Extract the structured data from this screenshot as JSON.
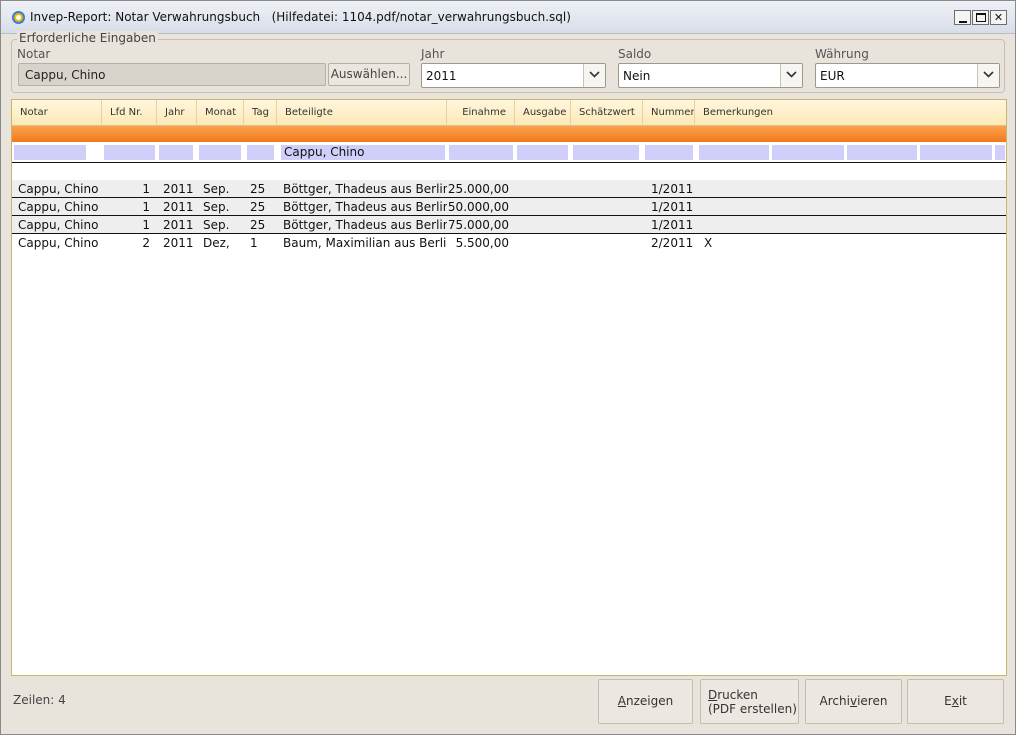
{
  "window": {
    "title": "Invep-Report: Notar Verwahrungsbuch   (Hilfedatei: 1104.pdf/notar_verwahrungsbuch.sql)",
    "controls": {
      "minimize": "_",
      "maximize": "□",
      "close": "✕"
    }
  },
  "inputs": {
    "legend": "Erforderliche Eingaben",
    "notar": {
      "label": "Notar",
      "value": "Cappu, Chino",
      "button": "Auswählen..."
    },
    "jahr": {
      "label": "Jahr",
      "value": "2011"
    },
    "saldo": {
      "label": "Saldo",
      "value": "Nein"
    },
    "waehrung": {
      "label": "Währung",
      "value": "EUR"
    }
  },
  "table": {
    "columns": [
      "Notar",
      "Lfd Nr.",
      "Jahr",
      "Monat",
      "Tag",
      "Beteiligte",
      "Einahme",
      "Ausgabe",
      "Schätzwert",
      "Nummer",
      "Bemerkungen"
    ],
    "filter": {
      "beteiligte": "Cappu, Chino"
    },
    "rows": [
      {
        "notar": "Cappu, Chino",
        "lfd": "1",
        "jahr": "2011",
        "monat": "Sep.",
        "tag": "25",
        "beteiligte": "Böttger, Thadeus aus Berlin",
        "einahme": "25.000,00",
        "ausgabe": "",
        "schaetzwert": "",
        "nummer": "1/2011",
        "bemerkungen": ""
      },
      {
        "notar": "Cappu, Chino",
        "lfd": "1",
        "jahr": "2011",
        "monat": "Sep.",
        "tag": "25",
        "beteiligte": "Böttger, Thadeus aus Berlin",
        "einahme": "50.000,00",
        "ausgabe": "",
        "schaetzwert": "",
        "nummer": "1/2011",
        "bemerkungen": ""
      },
      {
        "notar": "Cappu, Chino",
        "lfd": "1",
        "jahr": "2011",
        "monat": "Sep.",
        "tag": "25",
        "beteiligte": "Böttger, Thadeus aus Berlin",
        "einahme": "75.000,00",
        "ausgabe": "",
        "schaetzwert": "",
        "nummer": "1/2011",
        "bemerkungen": ""
      },
      {
        "notar": "Cappu, Chino",
        "lfd": "2",
        "jahr": "2011",
        "monat": "Dez,",
        "tag": "1",
        "beteiligte": "Baum, Maximilian aus Berlin",
        "einahme": "5.500,00",
        "ausgabe": "",
        "schaetzwert": "",
        "nummer": "2/2011",
        "bemerkungen": "X"
      }
    ]
  },
  "footer": {
    "status": "Zeilen: 4",
    "buttons": {
      "anzeigen_pre": "",
      "anzeigen_u": "A",
      "anzeigen_post": "nzeigen",
      "drucken_u": "D",
      "drucken_post": "rucken",
      "drucken_line2": "(PDF erstellen)",
      "archivieren_pre": "Archi",
      "archivieren_u": "v",
      "archivieren_post": "ieren",
      "exit_pre": "E",
      "exit_u": "x",
      "exit_post": "it"
    }
  },
  "colors": {
    "header_orange": "#f27a1a",
    "filter_lavender": "#cfcff9",
    "row_alt": "#eeeeee"
  }
}
